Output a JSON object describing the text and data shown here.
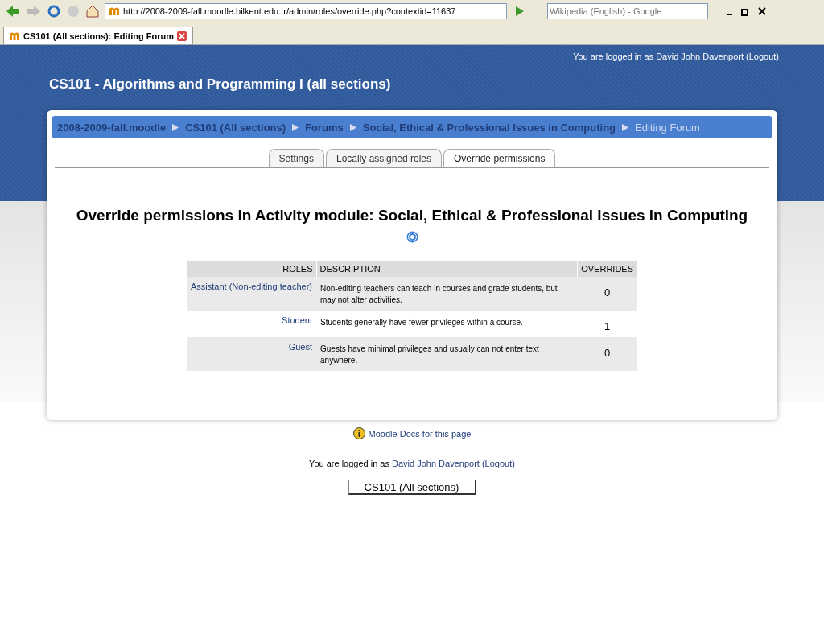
{
  "browser": {
    "url": "http://2008-2009-fall.moodle.bilkent.edu.tr/admin/roles/override.php?contextid=11637",
    "search_placeholder": "Wikipedia (English) - Google",
    "tab_title": "CS101 (All sections): Editing Forum"
  },
  "header": {
    "login_text": "You are logged in as David John Davenport (Logout)",
    "course_title": "CS101 - Algorithms and Programming I (all sections)"
  },
  "breadcrumb": [
    {
      "label": "2008-2009-fall.moodle",
      "kind": "link"
    },
    {
      "label": "CS101 (All sections)",
      "kind": "link"
    },
    {
      "label": "Forums",
      "kind": "link"
    },
    {
      "label": "Social, Ethical & Professional Issues in Computing",
      "kind": "link"
    },
    {
      "label": "Editing Forum",
      "kind": "current"
    }
  ],
  "tabs": [
    {
      "label": "Settings",
      "selected": false
    },
    {
      "label": "Locally assigned roles",
      "selected": false
    },
    {
      "label": "Override permissions",
      "selected": true
    }
  ],
  "heading": "Override permissions in Activity module: Social, Ethical & Professional Issues in Computing",
  "table": {
    "columns": [
      "ROLES",
      "DESCRIPTION",
      "OVERRIDES"
    ],
    "rows": [
      {
        "role": "Assistant (Non-editing teacher)",
        "description": "Non-editing teachers can teach in courses and grade students, but may not alter activities.",
        "overrides": "0"
      },
      {
        "role": "Student",
        "description": "Students generally have fewer privileges within a course.",
        "overrides": "1"
      },
      {
        "role": "Guest",
        "description": "Guests have minimal privileges and usually can not enter text anywhere.",
        "overrides": "0"
      }
    ]
  },
  "footer": {
    "docs_link": "Moodle Docs for this page",
    "login_prefix": "You are logged in as",
    "user_link": "David John Davenport",
    "logout_link": "(Logout)",
    "course_button": "CS101 (All sections)"
  }
}
